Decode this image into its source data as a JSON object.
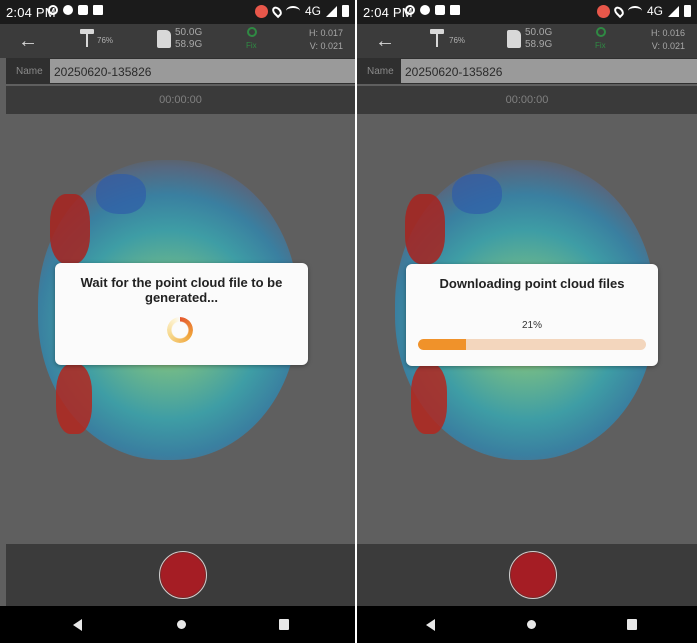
{
  "screens": [
    {
      "status": {
        "time": "2:04 PM",
        "network": "4G"
      },
      "toolbar": {
        "battery_pct": "76%",
        "storage_used": "50.0G",
        "storage_total": "58.9G",
        "fix_label": "Fix",
        "h_value": "H: 0.017",
        "v_value": "V: 0.021"
      },
      "name_label": "Name",
      "name_value": "20250620-135826",
      "timer": "00:00:00",
      "dialog": {
        "title": "Wait for the point cloud file to be generated...",
        "type": "spinner"
      }
    },
    {
      "status": {
        "time": "2:04 PM",
        "network": "4G"
      },
      "toolbar": {
        "battery_pct": "76%",
        "storage_used": "50.0G",
        "storage_total": "58.9G",
        "fix_label": "Fix",
        "h_value": "H: 0.016",
        "v_value": "V: 0.021"
      },
      "name_label": "Name",
      "name_value": "20250620-135826",
      "timer": "00:00:00",
      "dialog": {
        "title": "Downloading point cloud files",
        "type": "progress",
        "progress_text": "21%",
        "progress": 0.21
      }
    }
  ],
  "colors": {
    "record_button": "#a51d24",
    "progress_fill": "#f0922a",
    "progress_track": "#f3d6bd",
    "fix_green": "#2f8a43"
  },
  "icons": [
    "back-arrow-icon",
    "rover-antenna-icon",
    "sd-card-icon",
    "fix-status-icon",
    "record-icon",
    "nav-back-icon",
    "nav-home-icon",
    "nav-recent-icon"
  ]
}
